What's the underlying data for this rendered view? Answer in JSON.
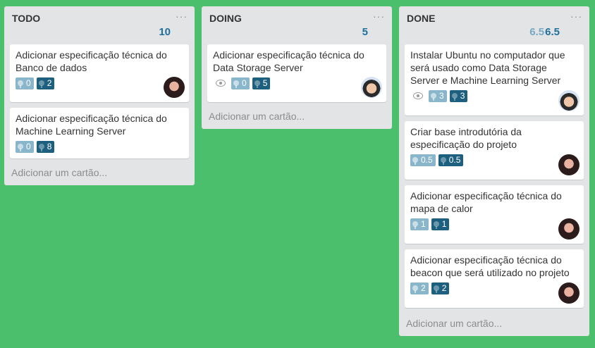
{
  "lists": [
    {
      "title": "TODO",
      "points_done": "10",
      "menu_icon": "ellipsis-icon",
      "cards": [
        {
          "title": "Adicionar especificação técnica do Banco de dados",
          "estimate": "0",
          "done": "2",
          "avatar": "avatar-1"
        },
        {
          "title": "Adicionar especificação técnica do Machine Learning Server",
          "estimate": "0",
          "done": "8"
        }
      ],
      "add_card": "Adicionar um cartão..."
    },
    {
      "title": "DOING",
      "points_done": "5",
      "menu_icon": "ellipsis-icon",
      "cards": [
        {
          "title": "Adicionar especificação técnica do Data Storage Server",
          "watch": true,
          "estimate": "0",
          "done": "5",
          "avatar": "avatar-2"
        }
      ],
      "add_card": "Adicionar um cartão..."
    },
    {
      "title": "DONE",
      "points_estimate": "6.5",
      "points_done": "6.5",
      "menu_icon": "ellipsis-icon",
      "cards": [
        {
          "title": "Instalar Ubuntu no computador que será usado como Data Storage Server e Machine Learning Server",
          "watch": true,
          "estimate": "3",
          "done": "3",
          "avatar": "avatar-2"
        },
        {
          "title": "Criar base introdutória da especificação do projeto",
          "estimate": "0.5",
          "done": "0.5",
          "avatar": "avatar-1"
        },
        {
          "title": "Adicionar especificação técnica do mapa de calor",
          "estimate": "1",
          "done": "1",
          "avatar": "avatar-1"
        },
        {
          "title": "Adicionar especificação técnica do beacon que será utilizado no projeto",
          "estimate": "2",
          "done": "2",
          "avatar": "avatar-1"
        }
      ],
      "add_card": "Adicionar um cartão..."
    }
  ],
  "colors": {
    "board_background": "#4bbf6b",
    "list_background": "#e2e4e6",
    "estimate_badge": "#8ab6cb",
    "done_badge": "#1d5f7e",
    "points_text": "#1f6f9b"
  }
}
